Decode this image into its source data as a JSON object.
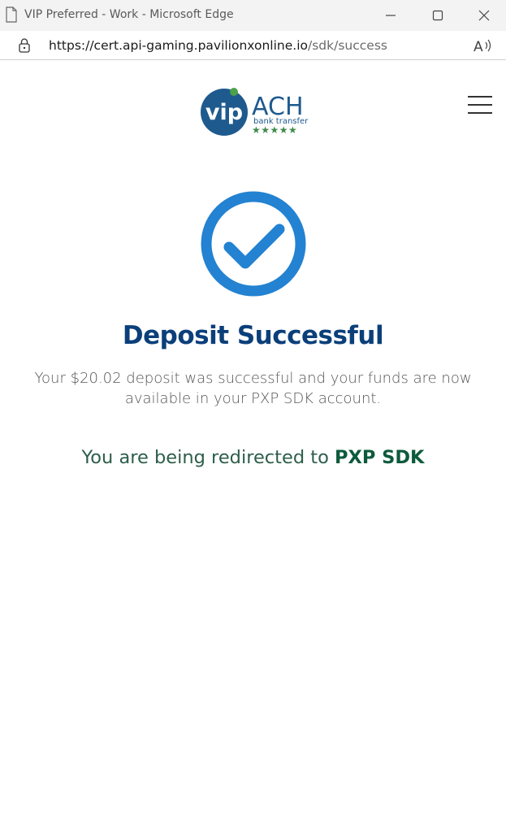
{
  "browser": {
    "window_title": "VIP Preferred - Work - Microsoft Edge",
    "url_host": "https://cert.api-gaming.pavilionxonline.io",
    "url_path": "/sdk/success"
  },
  "logo": {
    "vip_text": "vip",
    "ach_text": "ACH",
    "tagline": "bank transfer",
    "stars": "★★★★★"
  },
  "page": {
    "heading": "Deposit Successful",
    "message": "Your $20.02 deposit was successful and your funds are now available in your PXP SDK account.",
    "redirect_prefix": "You are being redirected to ",
    "redirect_target": "PXP SDK"
  },
  "colors": {
    "brand_blue": "#2382d1",
    "heading_blue": "#0b3f7a",
    "redirect_green": "#0d5a3c",
    "star_green": "#3f8a4a"
  },
  "icons": {
    "page": "page-icon",
    "lock": "lock-icon",
    "read_aloud": "read-aloud-icon",
    "menu": "hamburger-menu-icon",
    "success": "check-circle-icon"
  }
}
